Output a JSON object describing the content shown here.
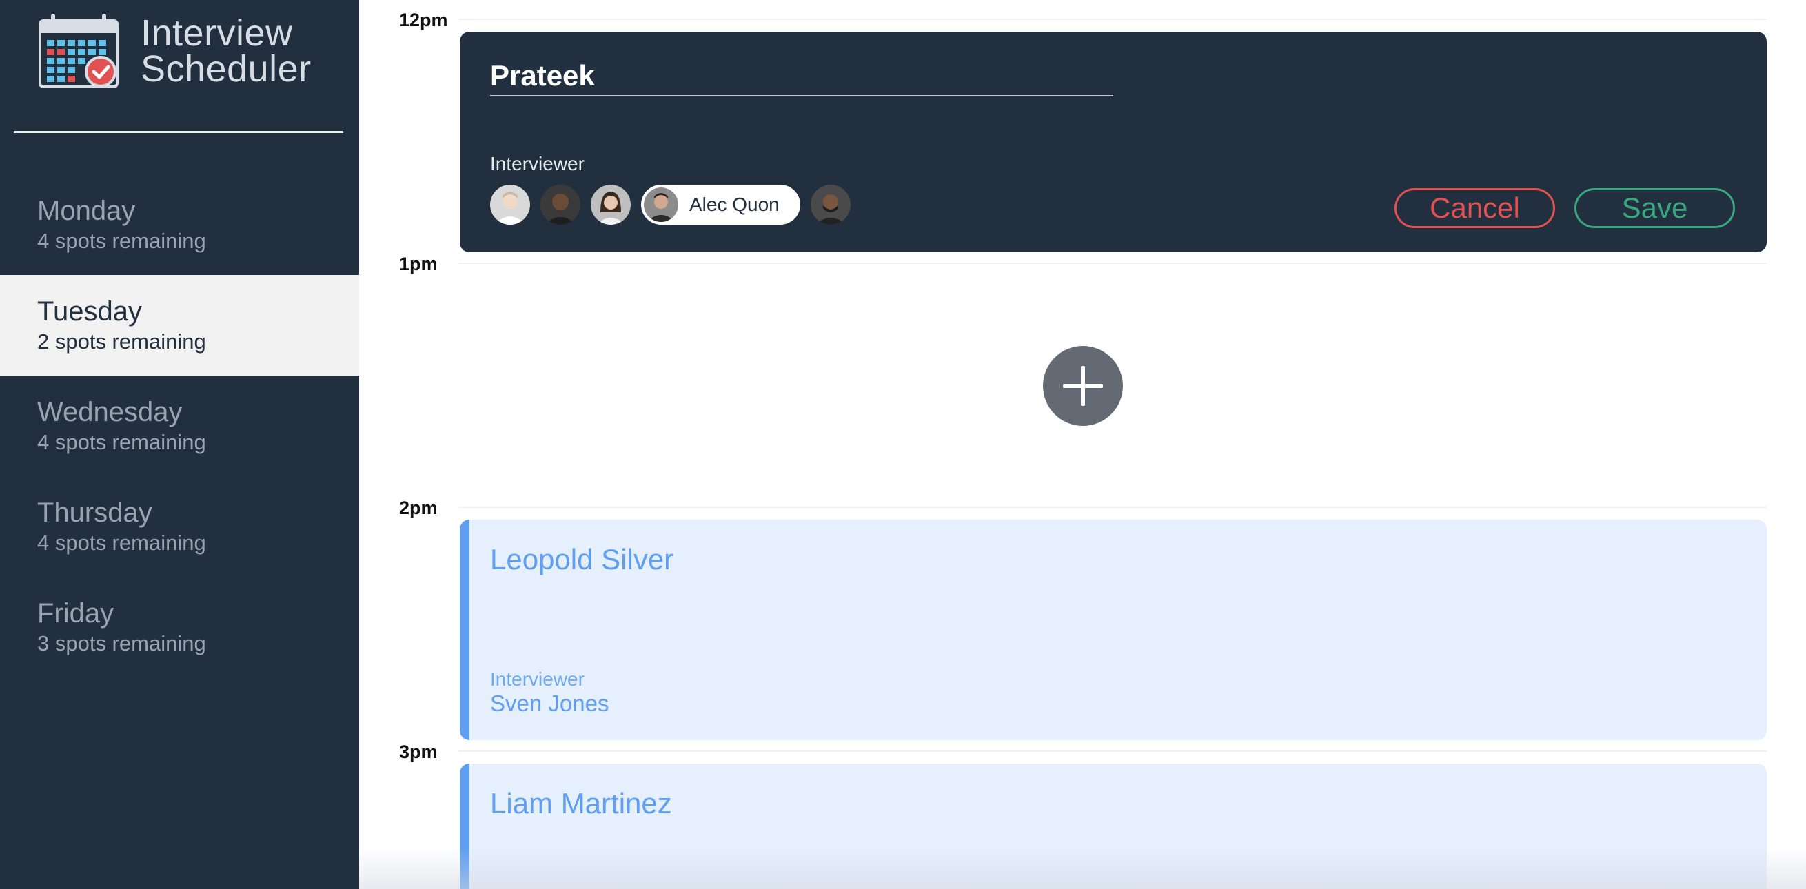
{
  "app": {
    "title_line1": "Interview",
    "title_line2": "Scheduler",
    "logo_icon": "calendar-check-icon"
  },
  "days": [
    {
      "name": "Monday",
      "spots": "4 spots remaining"
    },
    {
      "name": "Tuesday",
      "spots": "2 spots remaining"
    },
    {
      "name": "Wednesday",
      "spots": "4 spots remaining"
    },
    {
      "name": "Thursday",
      "spots": "4 spots remaining"
    },
    {
      "name": "Friday",
      "spots": "3 spots remaining"
    }
  ],
  "selected_day": "Tuesday",
  "hours": [
    "12pm",
    "1pm",
    "2pm",
    "3pm"
  ],
  "edit_form": {
    "student_name": "Prateek",
    "interviewer_heading": "Interviewer",
    "selected_interviewer": "Alec Quon",
    "cancel_label": "Cancel",
    "save_label": "Save"
  },
  "add_icon": "plus-icon",
  "appointments": [
    {
      "student": "Leopold Silver",
      "interviewer_label": "Interviewer",
      "interviewer": "Sven Jones"
    },
    {
      "student": "Liam Martinez"
    }
  ],
  "colors": {
    "sidebar_bg": "#222f3e",
    "card_dark": "#222f3e",
    "cancel": "#e05252",
    "save": "#39a77f",
    "appointment_bg": "#e6f0fd",
    "appointment_accent": "#5f9ef0"
  }
}
